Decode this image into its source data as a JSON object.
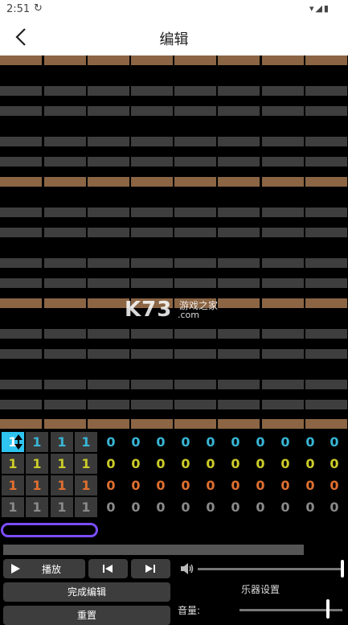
{
  "status_bar": {
    "time": "2:51",
    "sync_glyph": "↻",
    "right_glyphs": "▾◢▮"
  },
  "app_bar": {
    "title": "编辑"
  },
  "watermark": {
    "logo": "K73",
    "tagline": "游戏之家",
    "domain": ".com"
  },
  "grid": {
    "rows": [
      {
        "y": 0,
        "type": "accent"
      },
      {
        "y": 0,
        "type": "dark"
      }
    ]
  },
  "note_rows": [
    {
      "color": "#38b6d6",
      "values": [
        "1",
        "1",
        "1",
        "1",
        "0",
        "0",
        "0",
        "0",
        "0",
        "0",
        "0",
        "0",
        "0",
        "0"
      ]
    },
    {
      "color": "#cccc2a",
      "values": [
        "1",
        "1",
        "1",
        "1",
        "0",
        "0",
        "0",
        "0",
        "0",
        "0",
        "0",
        "0",
        "0",
        "0"
      ]
    },
    {
      "color": "#e07030",
      "values": [
        "1",
        "1",
        "1",
        "1",
        "0",
        "0",
        "0",
        "0",
        "0",
        "0",
        "0",
        "0",
        "0",
        "0"
      ]
    },
    {
      "color": "#8a8a8a",
      "values": [
        "1",
        "1",
        "1",
        "1",
        "0",
        "0",
        "0",
        "0",
        "0",
        "0",
        "0",
        "0",
        "0",
        "0"
      ]
    }
  ],
  "controls": {
    "play_label": "播放",
    "finish_edit_label": "完成编辑",
    "reset_label": "重置",
    "instrument_settings_label": "乐器设置",
    "volume_label": "音量:"
  },
  "colors": {
    "accent": "#8b6544",
    "dark": "#3e3e3e",
    "pill": "#7b4dff",
    "selected": "#2fc4f0"
  },
  "icons": {
    "back": "chevron-left-icon",
    "play": "play-icon",
    "prev": "skip-back-icon",
    "next": "skip-forward-icon",
    "volume": "speaker-icon"
  }
}
